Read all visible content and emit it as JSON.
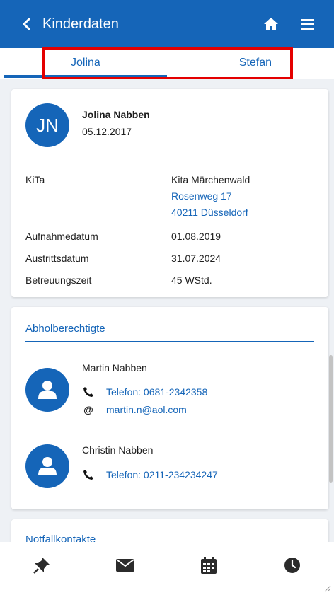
{
  "header": {
    "title": "Kinderdaten",
    "icons": [
      "back-icon",
      "home-icon",
      "menu-icon"
    ]
  },
  "tabs": [
    {
      "label": "Jolina",
      "active": true
    },
    {
      "label": "Stefan",
      "active": false
    }
  ],
  "child": {
    "initials": "JN",
    "name": "Jolina Nabben",
    "birthdate": "05.12.2017",
    "kita_label": "KiTa",
    "kita_name": "Kita Märchenwald",
    "kita_street": "Rosenweg 17",
    "kita_city": "40211 Düsseldorf",
    "admission_label": "Aufnahmedatum",
    "admission_value": "01.08.2019",
    "exit_label": "Austrittsdatum",
    "exit_value": "31.07.2024",
    "care_label": "Betreuungszeit",
    "care_value": "45 WStd."
  },
  "pickup": {
    "title": "Abholberechtigte",
    "persons": [
      {
        "name": "Martin Nabben",
        "phone": "Telefon: 0681-2342358",
        "email": "martin.n@aol.com"
      },
      {
        "name": "Christin Nabben",
        "phone": "Telefon: 0211-234234247"
      }
    ]
  },
  "emergency": {
    "title": "Notfallkontakte"
  },
  "bottom_nav": [
    "pin-icon",
    "mail-icon",
    "calendar-icon",
    "clock-icon"
  ],
  "colors": {
    "primary": "#1565b8",
    "highlight": "#e40000",
    "background": "#eef1f5"
  }
}
